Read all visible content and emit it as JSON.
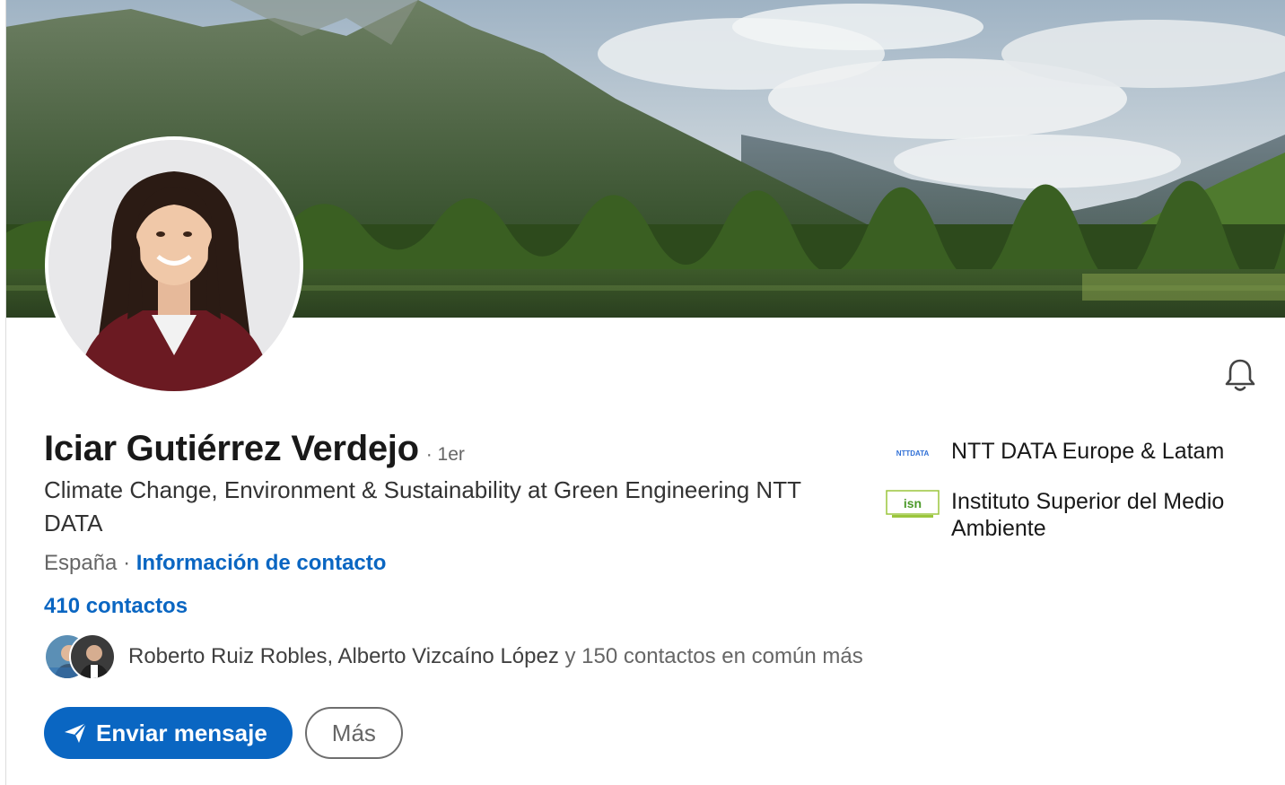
{
  "profile": {
    "name": "Iciar Gutiérrez Verdejo",
    "degree": "· 1er",
    "headline": "Climate Change, Environment & Sustainability at Green Engineering NTT DATA",
    "location": "España ·",
    "contact_info_label": "Información de contacto",
    "connections": "410 contactos"
  },
  "mutual": {
    "names": "Roberto Ruiz Robles, Alberto Vizcaíno López",
    "rest": "y 150 contactos en común más"
  },
  "actions": {
    "message_label": "Enviar mensaje",
    "more_label": "Más"
  },
  "companies": [
    {
      "name": "NTT DATA Europe & Latam",
      "logo_text": "NTTDATA",
      "icon": "ntt-data-logo"
    },
    {
      "name": "Instituto Superior del Medio Ambiente",
      "logo_text": "isn",
      "icon": "isma-logo"
    }
  ],
  "icons": {
    "notification": "bell-icon",
    "send": "paper-plane-icon"
  },
  "colors": {
    "accent": "#0a66c2",
    "text_primary": "#191919",
    "text_secondary": "#666666"
  }
}
